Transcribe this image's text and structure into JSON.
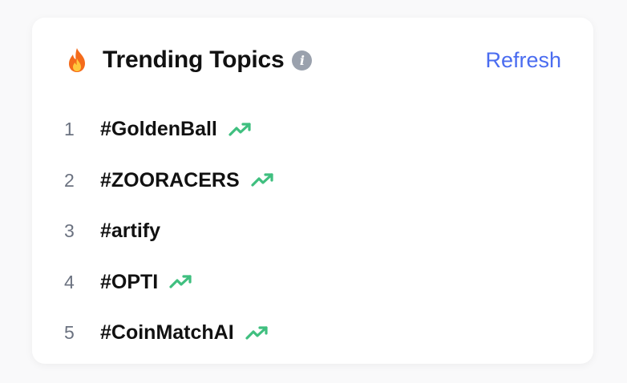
{
  "header": {
    "icon": "fire-icon",
    "title": "Trending Topics",
    "info_icon": "info-icon",
    "info_glyph": "i",
    "refresh_label": "Refresh"
  },
  "colors": {
    "accent": "#4a6cf0",
    "trend_up": "#3fbf7f",
    "title": "#111111",
    "rank": "#6b7280"
  },
  "topics": [
    {
      "rank": "1",
      "tag": "#GoldenBall",
      "trending": true
    },
    {
      "rank": "2",
      "tag": "#ZOORACERS",
      "trending": true
    },
    {
      "rank": "3",
      "tag": "#artify",
      "trending": false
    },
    {
      "rank": "4",
      "tag": "#OPTI",
      "trending": true
    },
    {
      "rank": "5",
      "tag": "#CoinMatchAI",
      "trending": true
    }
  ]
}
